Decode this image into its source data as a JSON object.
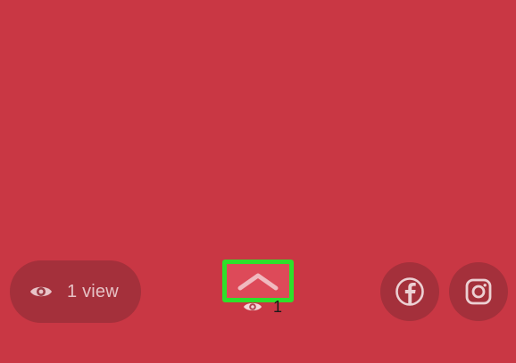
{
  "story": {
    "background_color": "#c93744"
  },
  "views": {
    "icon": "eye-icon",
    "label": "1 view"
  },
  "swipe_up": {
    "icon": "chevron-up-icon",
    "highlight_color": "#2ee02a"
  },
  "mini_views": {
    "icon": "eye-icon",
    "count": "1"
  },
  "share": {
    "facebook_icon": "facebook-icon",
    "instagram_icon": "instagram-icon"
  }
}
